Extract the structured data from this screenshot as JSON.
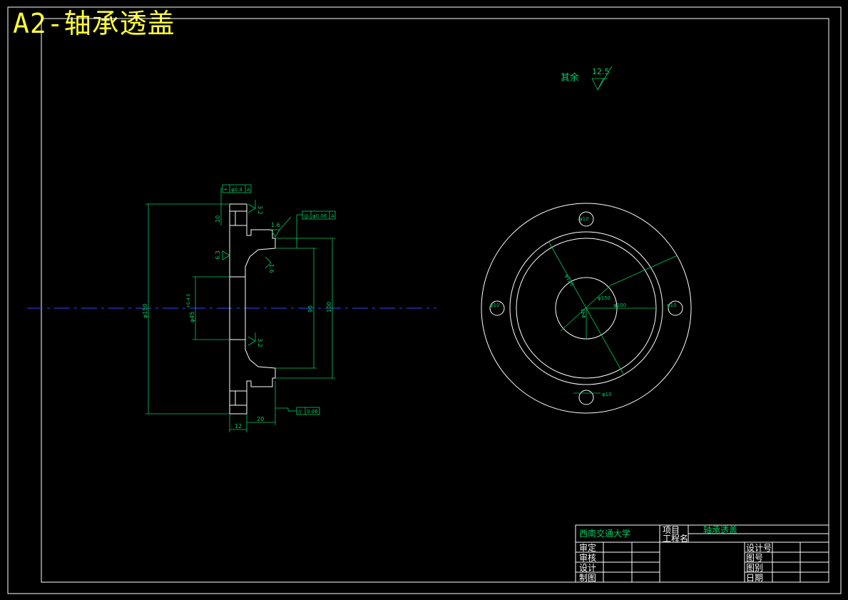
{
  "title": "A2-轴承透盖",
  "roughness": {
    "other_label": "其余",
    "other_value": "12.5"
  },
  "section_view": {
    "tolerance_top": {
      "symbol": "⌖",
      "value": "φ0.4",
      "datum": "A"
    },
    "tolerance_right": {
      "symbol": "◎",
      "value": "φ0.06",
      "datum": "A"
    },
    "tolerance_bottom": {
      "symbol": "//",
      "value": "0.06"
    },
    "roughness_labels": [
      "3.2",
      "1.6",
      "6.3",
      "1.6",
      "3.2"
    ],
    "dims": {
      "d10": "10",
      "d150": "φ150",
      "d45": "φ45",
      "d45_tol": "+0.4 0",
      "d95": "95",
      "d100": "100",
      "d12": "12",
      "d20": "20"
    }
  },
  "plan_view": {
    "d_outer": "φ150",
    "d_pcd": "φ120",
    "d_inner": "φ100",
    "d_bore": "φ45",
    "d_hole": "φ10"
  },
  "title_block": {
    "school": "西南交通大学",
    "project_label": "项目",
    "project_name_label": "工程名",
    "part_name": "轴承透盖",
    "left_labels": [
      "审定",
      "审核",
      "设计",
      "制图"
    ],
    "right_labels": [
      "设计号",
      "图号",
      "图别",
      "日期"
    ]
  }
}
